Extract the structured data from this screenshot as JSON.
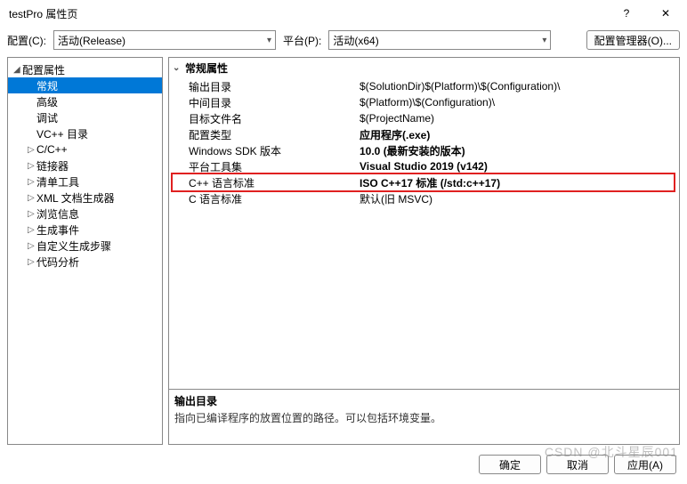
{
  "title": "testPro 属性页",
  "toolbar": {
    "config_label": "配置(C):",
    "config_value": "活动(Release)",
    "platform_label": "平台(P):",
    "platform_value": "活动(x64)",
    "manager_btn": "配置管理器(O)..."
  },
  "tree": {
    "root": "配置属性",
    "items": [
      {
        "label": "常规",
        "selected": true
      },
      {
        "label": "高级"
      },
      {
        "label": "调试"
      },
      {
        "label": "VC++ 目录"
      },
      {
        "label": "C/C++",
        "expandable": true
      },
      {
        "label": "链接器",
        "expandable": true
      },
      {
        "label": "清单工具",
        "expandable": true
      },
      {
        "label": "XML 文档生成器",
        "expandable": true
      },
      {
        "label": "浏览信息",
        "expandable": true
      },
      {
        "label": "生成事件",
        "expandable": true
      },
      {
        "label": "自定义生成步骤",
        "expandable": true
      },
      {
        "label": "代码分析",
        "expandable": true
      }
    ]
  },
  "props": {
    "group": "常规属性",
    "rows": [
      {
        "name": "输出目录",
        "value": "$(SolutionDir)$(Platform)\\$(Configuration)\\"
      },
      {
        "name": "中间目录",
        "value": "$(Platform)\\$(Configuration)\\"
      },
      {
        "name": "目标文件名",
        "value": "$(ProjectName)"
      },
      {
        "name": "配置类型",
        "value": "应用程序(.exe)",
        "bold": true
      },
      {
        "name": "Windows SDK 版本",
        "value": "10.0 (最新安装的版本)",
        "bold": true
      },
      {
        "name": "平台工具集",
        "value": "Visual Studio 2019 (v142)",
        "bold": true
      },
      {
        "name": "C++ 语言标准",
        "value": "ISO C++17 标准 (/std:c++17)",
        "bold": true,
        "highlight": true
      },
      {
        "name": "C 语言标准",
        "value": "默认(旧 MSVC)"
      }
    ]
  },
  "desc": {
    "title": "输出目录",
    "body": "指向已编译程序的放置位置的路径。可以包括环境变量。"
  },
  "footer": {
    "ok": "确定",
    "cancel": "取消",
    "apply": "应用(A)"
  },
  "watermark": "CSDN @北斗星辰001"
}
